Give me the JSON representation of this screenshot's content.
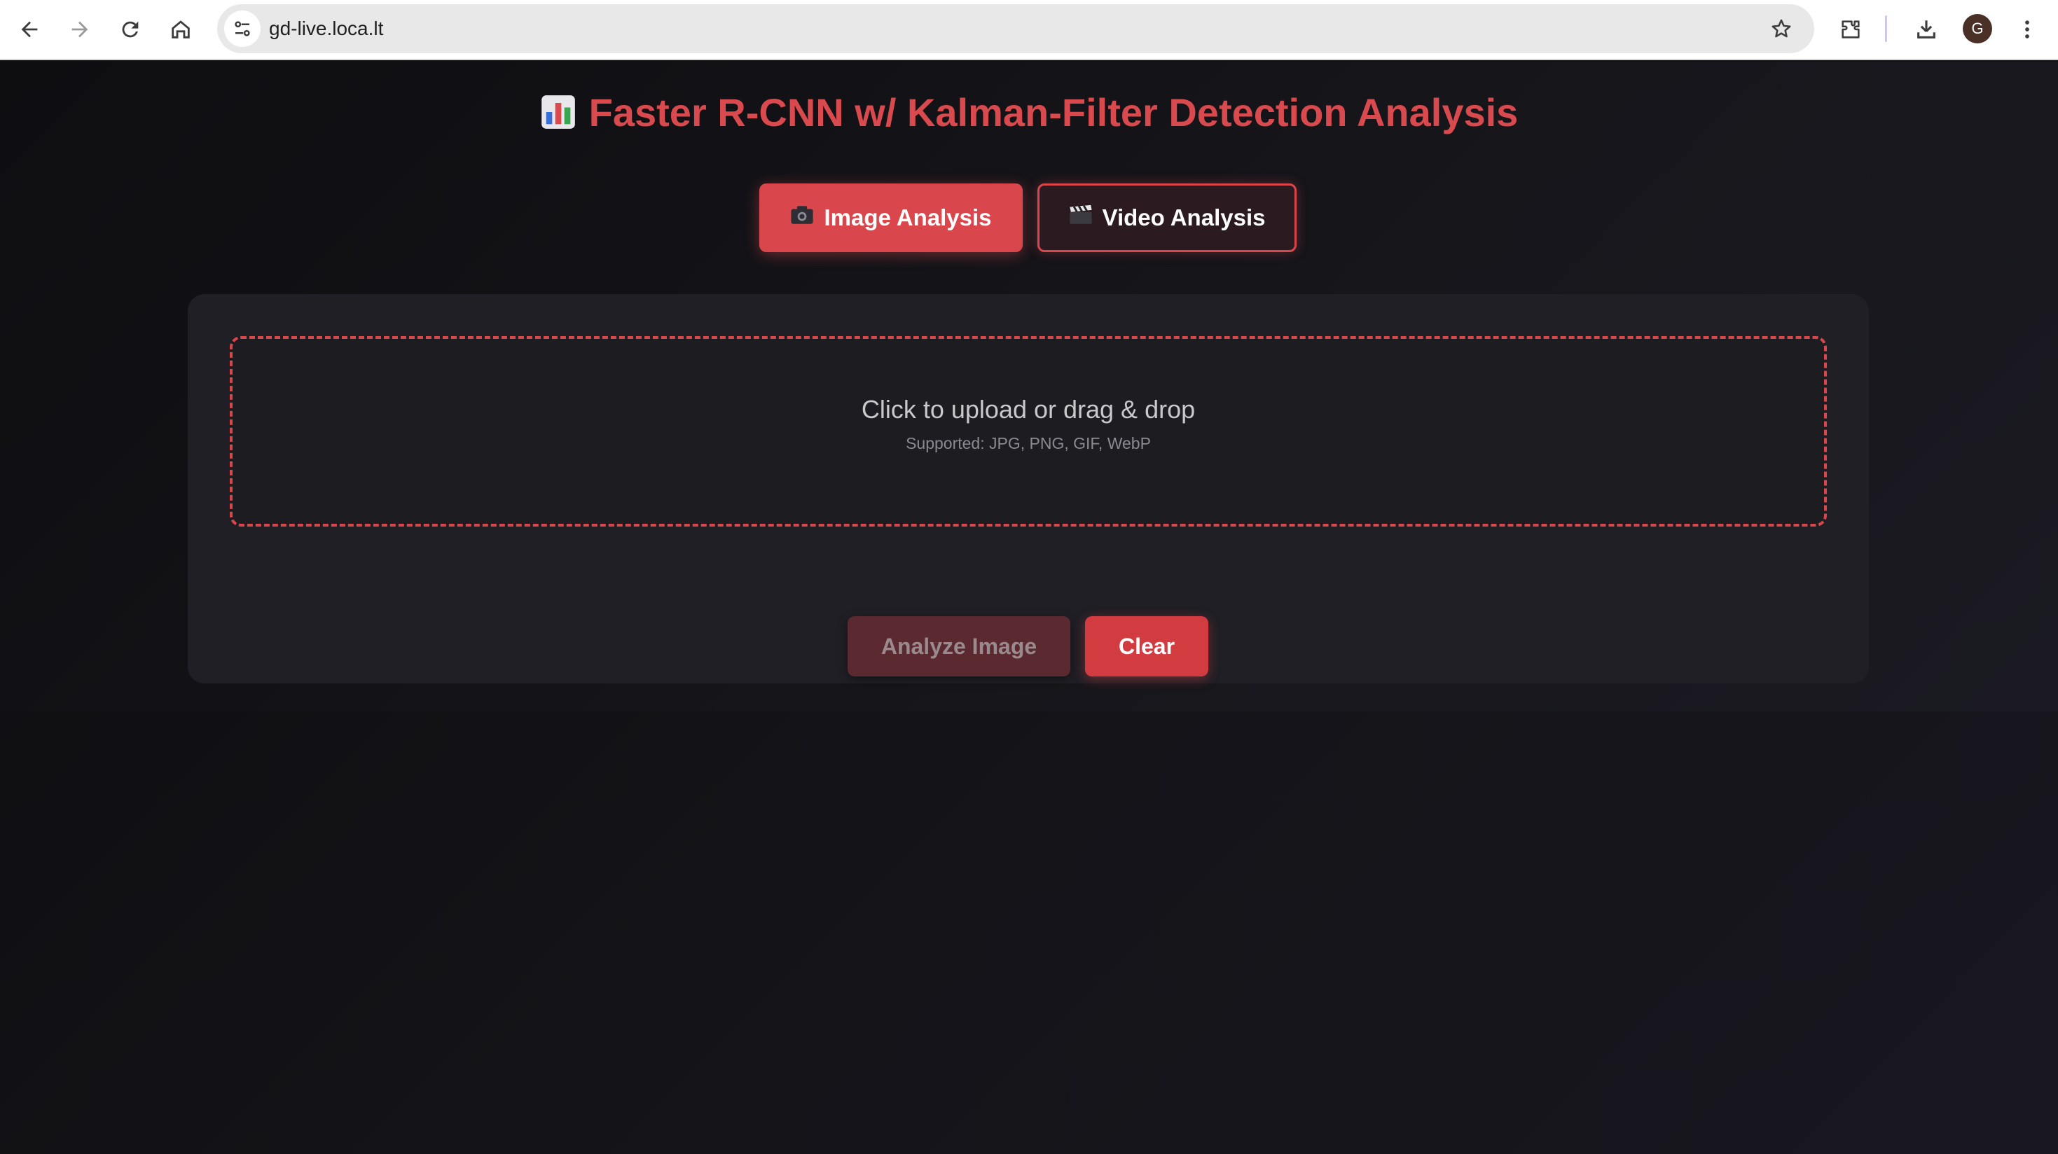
{
  "browser": {
    "url": "gd-live.loca.lt",
    "profile_initial": "G",
    "icons": {
      "back": "back-arrow-icon",
      "forward": "forward-arrow-icon",
      "reload": "reload-icon",
      "home": "home-icon",
      "site_info": "site-settings-icon",
      "bookmark": "star-icon",
      "extensions": "puzzle-icon",
      "downloads": "download-icon",
      "menu": "kebab-menu-icon"
    }
  },
  "header": {
    "title_icon": "bar-chart-icon",
    "title": "Faster R-CNN w/ Kalman-Filter Detection Analysis"
  },
  "tabs": [
    {
      "icon": "camera-icon",
      "label": "Image Analysis",
      "active": true
    },
    {
      "icon": "clapperboard-icon",
      "label": "Video Analysis",
      "active": false
    }
  ],
  "upload": {
    "main_text": "Click to upload or drag & drop",
    "supported_text": "Supported: JPG, PNG, GIF, WebP"
  },
  "actions": {
    "analyze_label": "Analyze Image",
    "analyze_disabled": true,
    "clear_label": "Clear"
  },
  "colors": {
    "accent": "#d9474d",
    "page_background": "#0f0f12",
    "card_background": "#1f1f25"
  }
}
